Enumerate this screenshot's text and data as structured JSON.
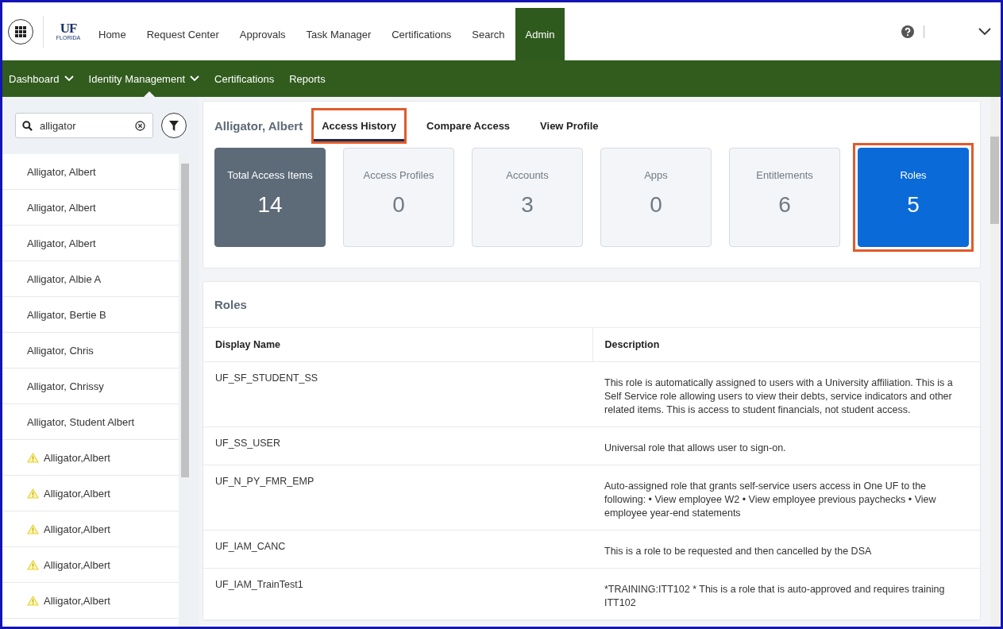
{
  "top_nav": {
    "logo": {
      "text": "UF",
      "subtext": "FLORIDA"
    },
    "items": [
      {
        "label": "Home",
        "selected": false
      },
      {
        "label": "Request Center",
        "selected": false
      },
      {
        "label": "Approvals",
        "selected": false
      },
      {
        "label": "Task Manager",
        "selected": false
      },
      {
        "label": "Certifications",
        "selected": false
      },
      {
        "label": "Search",
        "selected": false
      },
      {
        "label": "Admin",
        "selected": true
      }
    ]
  },
  "sub_nav": [
    {
      "label": "Dashboard",
      "dropdown": true,
      "selected": false
    },
    {
      "label": "Identity Management",
      "dropdown": true,
      "selected": true
    },
    {
      "label": "Certifications",
      "dropdown": false,
      "selected": false
    },
    {
      "label": "Reports",
      "dropdown": false,
      "selected": false
    }
  ],
  "sidebar": {
    "search": {
      "value": "alligator"
    },
    "items": [
      {
        "name": "Alligator, Albert",
        "warning": false
      },
      {
        "name": "Alligator, Albert",
        "warning": false
      },
      {
        "name": "Alligator, Albert",
        "warning": false
      },
      {
        "name": "Alligator, Albie A",
        "warning": false
      },
      {
        "name": "Alligator, Bertie B",
        "warning": false
      },
      {
        "name": "Alligator, Chris",
        "warning": false
      },
      {
        "name": "Alligator, Chrissy",
        "warning": false
      },
      {
        "name": "Alligator, Student Albert",
        "warning": false
      },
      {
        "name": "Alligator,Albert",
        "warning": true
      },
      {
        "name": "Alligator,Albert",
        "warning": true
      },
      {
        "name": "Alligator,Albert",
        "warning": true
      },
      {
        "name": "Alligator,Albert",
        "warning": true
      },
      {
        "name": "Alligator,Albert",
        "warning": true
      }
    ]
  },
  "identity": {
    "name": "Alligator, Albert",
    "tabs": [
      {
        "label": "Access History",
        "selected": true,
        "highlighted": true
      },
      {
        "label": "Compare Access",
        "selected": false,
        "highlighted": false
      },
      {
        "label": "View Profile",
        "selected": false,
        "highlighted": false
      }
    ]
  },
  "tiles": [
    {
      "kind": "total",
      "label": "Total Access Items",
      "value": "14",
      "selected": false,
      "highlighted": false
    },
    {
      "kind": "category",
      "label": "Access Profiles",
      "value": "0",
      "selected": false,
      "highlighted": false
    },
    {
      "kind": "category",
      "label": "Accounts",
      "value": "3",
      "selected": false,
      "highlighted": false
    },
    {
      "kind": "category",
      "label": "Apps",
      "value": "0",
      "selected": false,
      "highlighted": false
    },
    {
      "kind": "category",
      "label": "Entitlements",
      "value": "6",
      "selected": false,
      "highlighted": false
    },
    {
      "kind": "category",
      "label": "Roles",
      "value": "5",
      "selected": true,
      "highlighted": true
    }
  ],
  "roles": {
    "title": "Roles",
    "columns": [
      "Display Name",
      "Description"
    ],
    "rows": [
      {
        "display_name": "UF_SF_STUDENT_SS",
        "description": "This role is automatically assigned to users with a University affiliation. This is a Self Service role allowing users to view their debts, service indicators and other related items. This is access to student financials, not student access."
      },
      {
        "display_name": "UF_SS_USER",
        "description": "Universal role that allows user to sign-on."
      },
      {
        "display_name": "UF_N_PY_FMR_EMP",
        "description": "Auto-assigned role that grants self-service users access in One UF to the following: • View employee W2 • View employee previous paychecks • View employee year-end statements"
      },
      {
        "display_name": "UF_IAM_CANC",
        "description": "This is a role to be requested and then cancelled by the DSA"
      },
      {
        "display_name": "UF_IAM_TrainTest1",
        "description": "*TRAINING:ITT102 * This is a role that is auto-approved and requires training ITT102"
      }
    ]
  }
}
